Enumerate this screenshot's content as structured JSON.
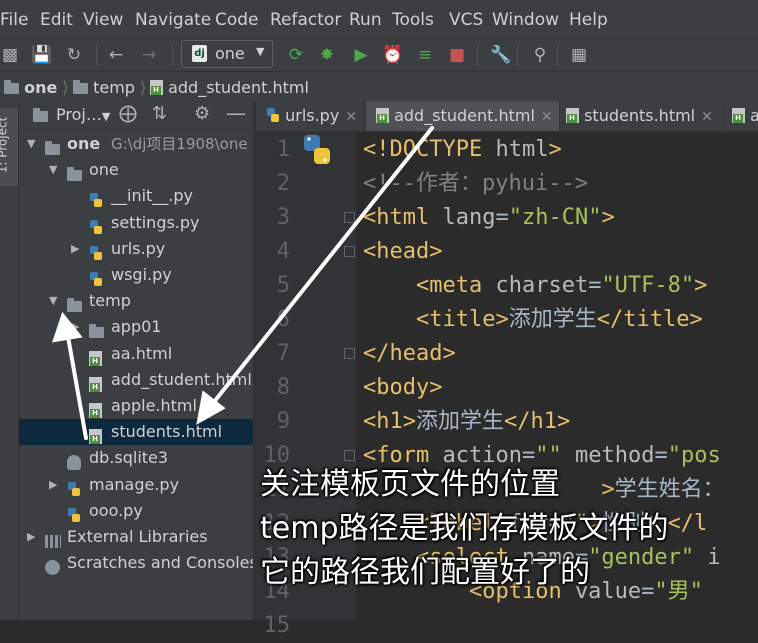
{
  "menu": [
    "File",
    "Edit",
    "View",
    "Navigate",
    "Code",
    "Refactor",
    "Run",
    "Tools",
    "VCS",
    "Window",
    "Help"
  ],
  "toolbar": {
    "run_config_label": "one",
    "icons": [
      "open-icon",
      "save-icon",
      "sync-icon",
      "back-icon",
      "forward-icon",
      "run-icon",
      "debug-icon",
      "coverage-icon",
      "profile-icon",
      "concurrency-icon",
      "stop-icon",
      "settings-wrench-icon",
      "search-icon",
      "structure-icon"
    ]
  },
  "breadcrumb": [
    "one",
    "temp",
    "add_student.html"
  ],
  "side_tab": "1: Project",
  "project_panel": {
    "title": "Proj…",
    "tree": [
      {
        "label": "one",
        "detail": "G:\\dj项目1908\\one",
        "kind": "folder",
        "indent": 0,
        "arrow": "▼"
      },
      {
        "label": "one",
        "kind": "folder",
        "indent": 1,
        "arrow": "▼"
      },
      {
        "label": "__init__.py",
        "kind": "py",
        "indent": 2,
        "arrow": ""
      },
      {
        "label": "settings.py",
        "kind": "py",
        "indent": 2,
        "arrow": ""
      },
      {
        "label": "urls.py",
        "kind": "py",
        "indent": 2,
        "arrow": "▶"
      },
      {
        "label": "wsgi.py",
        "kind": "py",
        "indent": 2,
        "arrow": ""
      },
      {
        "label": "temp",
        "kind": "folder",
        "indent": 1,
        "arrow": "▼"
      },
      {
        "label": "app01",
        "kind": "folder",
        "indent": 2,
        "arrow": "▶"
      },
      {
        "label": "aa.html",
        "kind": "html",
        "indent": 2,
        "arrow": ""
      },
      {
        "label": "add_student.html",
        "kind": "html",
        "indent": 2,
        "arrow": ""
      },
      {
        "label": "apple.html",
        "kind": "html",
        "indent": 2,
        "arrow": ""
      },
      {
        "label": "students.html",
        "kind": "html",
        "indent": 2,
        "arrow": "",
        "selected": true
      },
      {
        "label": "db.sqlite3",
        "kind": "db",
        "indent": 1,
        "arrow": ""
      },
      {
        "label": "manage.py",
        "kind": "py",
        "indent": 1,
        "arrow": "▶"
      },
      {
        "label": "ooo.py",
        "kind": "py",
        "indent": 1,
        "arrow": ""
      },
      {
        "label": "External Libraries",
        "kind": "libs",
        "indent": 0,
        "arrow": "▶"
      },
      {
        "label": "Scratches and Consoles",
        "kind": "scratch",
        "indent": 0,
        "arrow": ""
      }
    ]
  },
  "tabs": [
    {
      "label": "urls.py",
      "kind": "py",
      "active": false
    },
    {
      "label": "add_student.html",
      "kind": "html",
      "active": true
    },
    {
      "label": "students.html",
      "kind": "html",
      "active": false
    },
    {
      "label": "a",
      "kind": "html",
      "active": false
    }
  ],
  "editor": {
    "line_numbers": [
      "1",
      "2",
      "3",
      "4",
      "5",
      "6",
      "7",
      "8",
      "9",
      "10",
      "11",
      "12",
      "13",
      "14",
      "15"
    ],
    "lines": [
      [
        [
          "tag",
          "<!DOCTYPE "
        ],
        [
          "attr",
          "html"
        ],
        [
          "tag",
          ">"
        ]
      ],
      [
        [
          "cmt",
          "<!--作者：pyhui-->"
        ]
      ],
      [
        [
          "tag",
          "<html "
        ],
        [
          "attr",
          "lang"
        ],
        [
          "tx",
          "="
        ],
        [
          "val",
          "\"zh-CN\""
        ],
        [
          "tag",
          ">"
        ]
      ],
      [
        [
          "tag",
          "<head>"
        ]
      ],
      [
        [
          "tx",
          "    "
        ],
        [
          "tag",
          "<meta "
        ],
        [
          "attr",
          "charset"
        ],
        [
          "tx",
          "="
        ],
        [
          "val",
          "\"UTF-8\""
        ],
        [
          "tag",
          ">"
        ]
      ],
      [
        [
          "tx",
          "    "
        ],
        [
          "tag",
          "<title>"
        ],
        [
          "tx",
          "添加学生"
        ],
        [
          "tag",
          "</title>"
        ]
      ],
      [
        [
          "tag",
          "</head>"
        ]
      ],
      [
        [
          "tag",
          "<body>"
        ]
      ],
      [
        [
          "tag",
          "<h1>"
        ],
        [
          "tx",
          "添加学生"
        ],
        [
          "tag",
          "</h1>"
        ]
      ],
      [
        [
          "tag",
          "<form "
        ],
        [
          "attr",
          "action"
        ],
        [
          "tx",
          "="
        ],
        [
          "val",
          "\"\" "
        ],
        [
          "attr",
          "method"
        ],
        [
          "tx",
          "="
        ],
        [
          "val",
          "\"pos"
        ]
      ],
      [
        [
          "tx",
          "                  "
        ],
        [
          "tag",
          ">"
        ],
        [
          "tx",
          "学生姓名："
        ]
      ],
      [
        [
          "tx",
          "    "
        ],
        [
          "tag",
          "<label "
        ],
        [
          "attr",
          "for"
        ],
        [
          "tx",
          "="
        ],
        [
          "val",
          "\"\""
        ],
        [
          "tag",
          ">"
        ],
        [
          "tx",
          "性别："
        ],
        [
          "tag",
          "</l"
        ]
      ],
      [
        [
          "tx",
          "    "
        ],
        [
          "tag",
          "<select "
        ],
        [
          "attr",
          "name"
        ],
        [
          "tx",
          "="
        ],
        [
          "val",
          "\"gender\" "
        ],
        [
          "attr",
          "i"
        ]
      ],
      [
        [
          "tx",
          "        "
        ],
        [
          "tag",
          "<option "
        ],
        [
          "attr",
          "value"
        ],
        [
          "tx",
          "="
        ],
        [
          "val",
          "\"男\""
        ]
      ],
      [
        [
          "tx",
          ""
        ]
      ]
    ]
  },
  "annotation": {
    "lines": [
      "关注模板页文件的位置",
      "temp路径是我们存模板文件的",
      "它的路径我们配置好了的"
    ]
  }
}
